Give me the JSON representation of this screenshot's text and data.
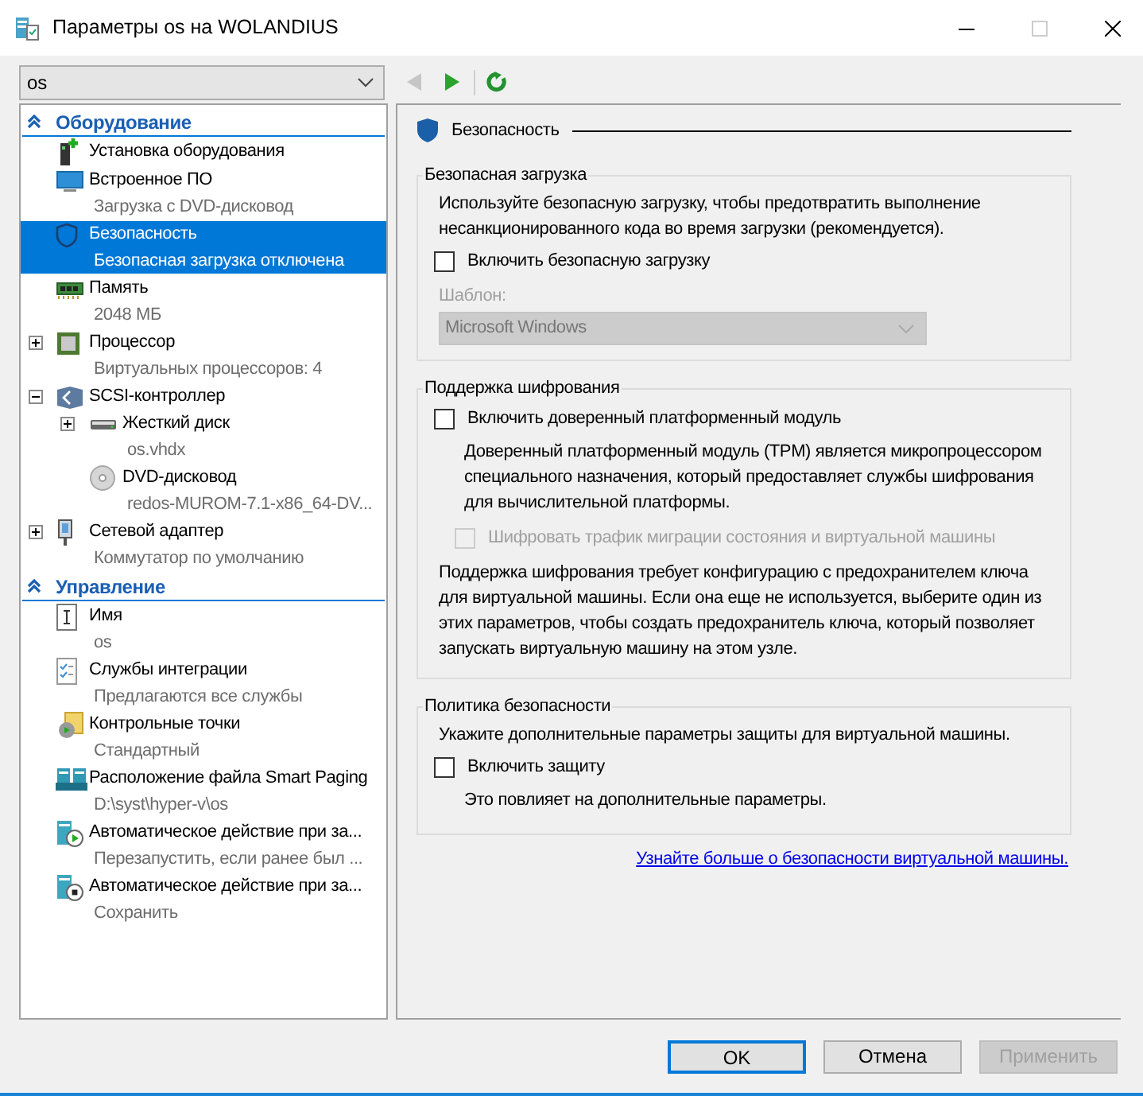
{
  "window": {
    "title": "Параметры os на WOLANDIUS"
  },
  "toolbar": {
    "vm_select": {
      "value": "os"
    },
    "back": {
      "disabled": true
    },
    "forward": {
      "disabled": false
    },
    "refresh": {
      "disabled": false
    }
  },
  "sidebar": {
    "sections": [
      {
        "title": "Оборудование",
        "expanded": true,
        "items": [
          {
            "label": "Установка оборудования",
            "selected": false
          },
          {
            "label": "Встроенное ПО",
            "detail": "Загрузка с DVD-дисковод",
            "selected": false
          },
          {
            "label": "Безопасность",
            "detail": "Безопасная загрузка отключена",
            "selected": true
          },
          {
            "label": "Память",
            "detail": "2048 МБ",
            "selected": false
          },
          {
            "label": "Процессор",
            "detail": "Виртуальных процессоров: 4",
            "selected": false,
            "expanded": false
          },
          {
            "label": "SCSI-контроллер",
            "selected": false,
            "expanded": true,
            "children": [
              {
                "label": "Жесткий диск",
                "detail": "os.vhdx",
                "selected": false,
                "expanded": false
              },
              {
                "label": "DVD-дисковод",
                "detail": "redos-MUROM-7.1-x86_64-DV...",
                "selected": false
              }
            ]
          },
          {
            "label": "Сетевой адаптер",
            "detail": "Коммутатор по умолчанию",
            "selected": false,
            "expanded": false
          }
        ]
      },
      {
        "title": "Управление",
        "expanded": true,
        "items": [
          {
            "label": "Имя",
            "detail": "os",
            "selected": false
          },
          {
            "label": "Службы интеграции",
            "detail": "Предлагаются все службы",
            "selected": false
          },
          {
            "label": "Контрольные точки",
            "detail": "Стандартный",
            "selected": false
          },
          {
            "label": "Расположение файла Smart Paging",
            "detail": "D:\\syst\\hyper-v\\os",
            "selected": false
          },
          {
            "label": "Автоматическое действие при за...",
            "detail": "Перезапустить, если ранее был ...",
            "selected": false
          },
          {
            "label": "Автоматическое действие при за...",
            "detail": "Сохранить",
            "selected": false
          }
        ]
      }
    ]
  },
  "content": {
    "title": "Безопасность",
    "groups": [
      {
        "title": "Безопасная загрузка",
        "items": [
          {
            "kind": "text",
            "text": "Используйте безопасную загрузку, чтобы предотвратить выполнение несанкционированного кода во время загрузки (рекомендуется)."
          },
          {
            "kind": "checkbox",
            "label": "Включить безопасную загрузку",
            "checked": false,
            "disabled": false
          },
          {
            "kind": "select",
            "label": "Шаблон:",
            "value": "Microsoft Windows",
            "disabled": true
          }
        ]
      },
      {
        "title": "Поддержка шифрования",
        "items": [
          {
            "kind": "checkbox",
            "label": "Включить доверенный платформенный модуль",
            "checked": false,
            "disabled": false
          },
          {
            "kind": "note",
            "text": "Доверенный платформенный модуль (TPM) является микропроцессором специального назначения, который предоставляет службы шифрования для вычислительной платформы."
          },
          {
            "kind": "subcheckbox",
            "label": "Шифровать трафик миграции состояния и виртуальной машины",
            "checked": false,
            "disabled": true
          },
          {
            "kind": "text",
            "text": "Поддержка шифрования требует конфигурацию с предохранителем ключа для виртуальной машины. Если она еще не используется, выберите один из этих параметров, чтобы создать предохранитель ключа, который позволяет запускать виртуальную машину на этом узле."
          }
        ]
      },
      {
        "title": "Политика безопасности",
        "items": [
          {
            "kind": "text",
            "text": "Укажите дополнительные параметры защиты для виртуальной машины."
          },
          {
            "kind": "checkbox",
            "label": "Включить защиту",
            "checked": false,
            "disabled": false
          },
          {
            "kind": "note",
            "text": "Это повлияет на дополнительные параметры."
          }
        ]
      }
    ],
    "link": "Узнайте больше о безопасности виртуальной машины."
  },
  "buttons": [
    {
      "label": "OK",
      "default": true,
      "disabled": false
    },
    {
      "label": "Отмена",
      "default": false,
      "disabled": false
    },
    {
      "label": "Применить",
      "default": false,
      "disabled": true
    }
  ]
}
